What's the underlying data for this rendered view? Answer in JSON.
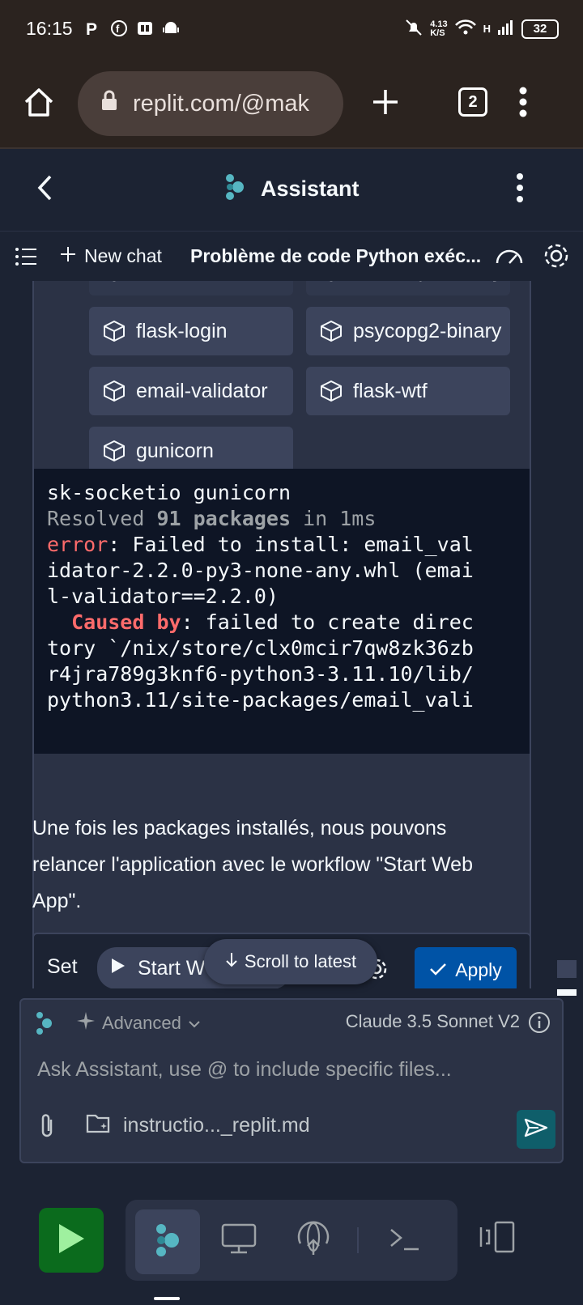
{
  "status_bar": {
    "time": "16:15",
    "net_speed_value": "4.13",
    "net_speed_unit": "K/S",
    "network": "H",
    "battery": "32"
  },
  "browser": {
    "url": "replit.com/@mak",
    "tab_count": "2"
  },
  "assistant_header": {
    "title": "Assistant"
  },
  "toolbar": {
    "new_chat_label": "New chat",
    "chat_title": "Problème de code Python exéc..."
  },
  "packages": [
    {
      "label": "flask-socketio",
      "faded": true
    },
    {
      "label": "flask-sqlalchemy",
      "faded": true
    },
    {
      "label": "flask-login"
    },
    {
      "label": "psycopg2-binary"
    },
    {
      "label": "email-validator"
    },
    {
      "label": "flask-wtf"
    },
    {
      "label": "gunicorn"
    }
  ],
  "terminal": {
    "line1": "sk-socketio gunicorn",
    "resolved_prefix": "Resolved ",
    "resolved_count": "91 packages",
    "resolved_suffix": " in 1ms",
    "error_label": "error",
    "error_line1": ": Failed to install: email_val",
    "error_line2": "idator-2.2.0-py3-none-any.whl (emai",
    "error_line3": "l-validator==2.2.0)",
    "caused_label": "  Caused by",
    "caused_line1": ": failed to create direc",
    "caused_line2": "tory `/nix/store/clx0mcir7qw8zk36zb",
    "caused_line3": "r4jra789g3knf6-python3-3.11.10/lib/",
    "caused_line4": "python3.11/site-packages/email_vali"
  },
  "message": {
    "text": "Une fois les packages installés, nous pouvons relancer l'application avec le workflow \"Start Web App\"."
  },
  "workflow_row": {
    "set_label": "Set",
    "start_label": "Start W",
    "apply_label": "Apply"
  },
  "scroll_to_latest": "Scroll to latest",
  "input": {
    "mode": "Advanced",
    "model": "Claude 3.5 Sonnet V2",
    "placeholder": "Ask Assistant, use @ to include specific files...",
    "attached_file": "instructio..._replit.md"
  },
  "colors": {
    "background": "#1c2333",
    "card": "#2b3245",
    "accent_blue": "#0053a6",
    "run_green": "#0b6b1d",
    "error_red": "#ff6b6b"
  }
}
